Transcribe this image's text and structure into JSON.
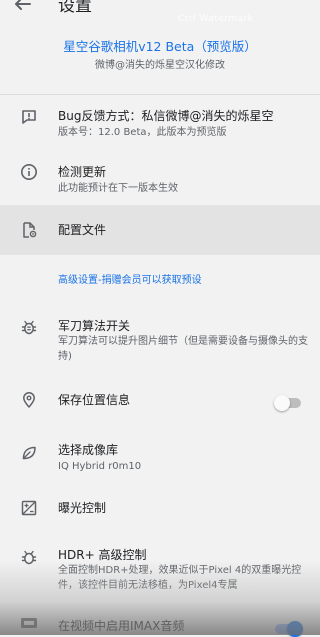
{
  "appbar": {
    "title": "设置",
    "back_icon": "arrow-back-icon",
    "watermark": "Ctrl Watermark"
  },
  "header": {
    "title": "星空谷歌相机v12 Beta（预览版）",
    "subtitle": "微博@消失的烁星空汉化修改"
  },
  "prefs": {
    "bug": {
      "icon": "feedback-icon",
      "title": "Bug反馈方式：私信微博@消失的烁星空",
      "summary": "版本号：12.0 Beta，此版本为预览版"
    },
    "update": {
      "icon": "info-icon",
      "title": "检测更新",
      "summary": "此功能预计在下一版本生效"
    },
    "config": {
      "icon": "settings-file-icon",
      "title": "配置文件"
    },
    "section": {
      "title": "高级设置-捐赠会员可以获取预设"
    },
    "sabre": {
      "icon": "bug-icon",
      "title": "军刀算法开关",
      "summary": "军刀算法可以提升图片细节（但是需要设备与摄像头的支持)"
    },
    "location": {
      "icon": "location-pin-icon",
      "title": "保存位置信息",
      "toggle_state": "off"
    },
    "library": {
      "icon": "leaf-icon",
      "title": "选择成像库",
      "summary": "IQ Hybrid r0m10"
    },
    "exposure": {
      "icon": "exposure-icon",
      "title": "曝光控制"
    },
    "hdr": {
      "icon": "hdr-bug-icon",
      "title": "HDR+ 高级控制",
      "summary": "全面控制HDR+处理，效果近似于Pixel 4的双重曝光控件，该控件目前无法移植，为Pixel4专属"
    },
    "imax": {
      "icon": "imax-icon",
      "title": "在视频中启用IMAX音频",
      "toggle_state": "on"
    }
  },
  "colors": {
    "accent": "#1a73e8",
    "background": "#f2f2f2",
    "highlight": "#e3e3e3",
    "text_primary": "#202124",
    "text_secondary": "#5f6368"
  }
}
